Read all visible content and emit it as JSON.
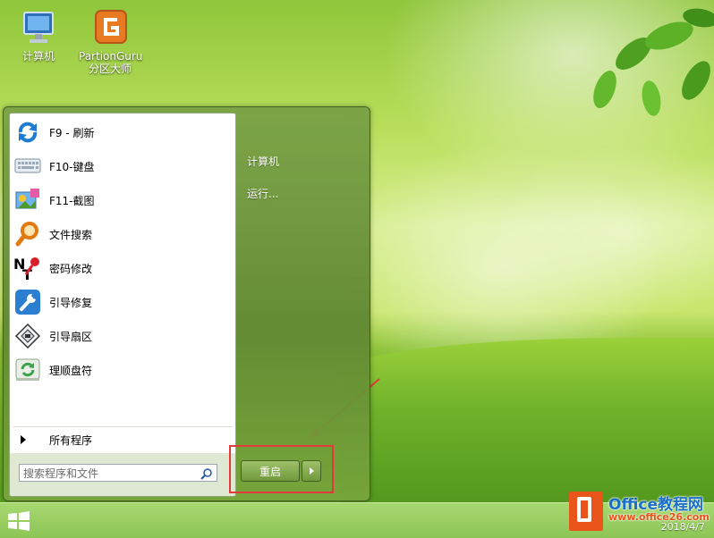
{
  "desktop": {
    "icons": [
      {
        "label": "计算机",
        "icon": "computer-icon"
      },
      {
        "label": "PartionGuru",
        "label2": "分区大师",
        "icon": "partitionguru-icon"
      }
    ]
  },
  "start_menu": {
    "items": [
      {
        "label": "F9 - 刷新",
        "icon": "refresh-icon"
      },
      {
        "label": "F10-键盘",
        "icon": "keyboard-icon"
      },
      {
        "label": "F11-截图",
        "icon": "screenshot-icon"
      },
      {
        "label": "文件搜索",
        "icon": "file-search-icon"
      },
      {
        "label": "密码修改",
        "icon": "password-key-icon"
      },
      {
        "label": "引导修复",
        "icon": "wrench-icon"
      },
      {
        "label": "引导扇区",
        "icon": "boot-sector-icon"
      },
      {
        "label": "理顺盘符",
        "icon": "drive-letter-icon"
      }
    ],
    "all_programs": "所有程序",
    "search_placeholder": "搜索程序和文件",
    "right": {
      "computer": "计算机",
      "run": "运行..."
    },
    "restart_label": "重启"
  },
  "taskbar": {
    "clock": "2018/4/7"
  },
  "watermark": {
    "line1": "Office教程网",
    "line2": "www.office26.com"
  },
  "colors": {
    "annotation_red": "#e03a3a",
    "menu_green": "#5f8732"
  }
}
